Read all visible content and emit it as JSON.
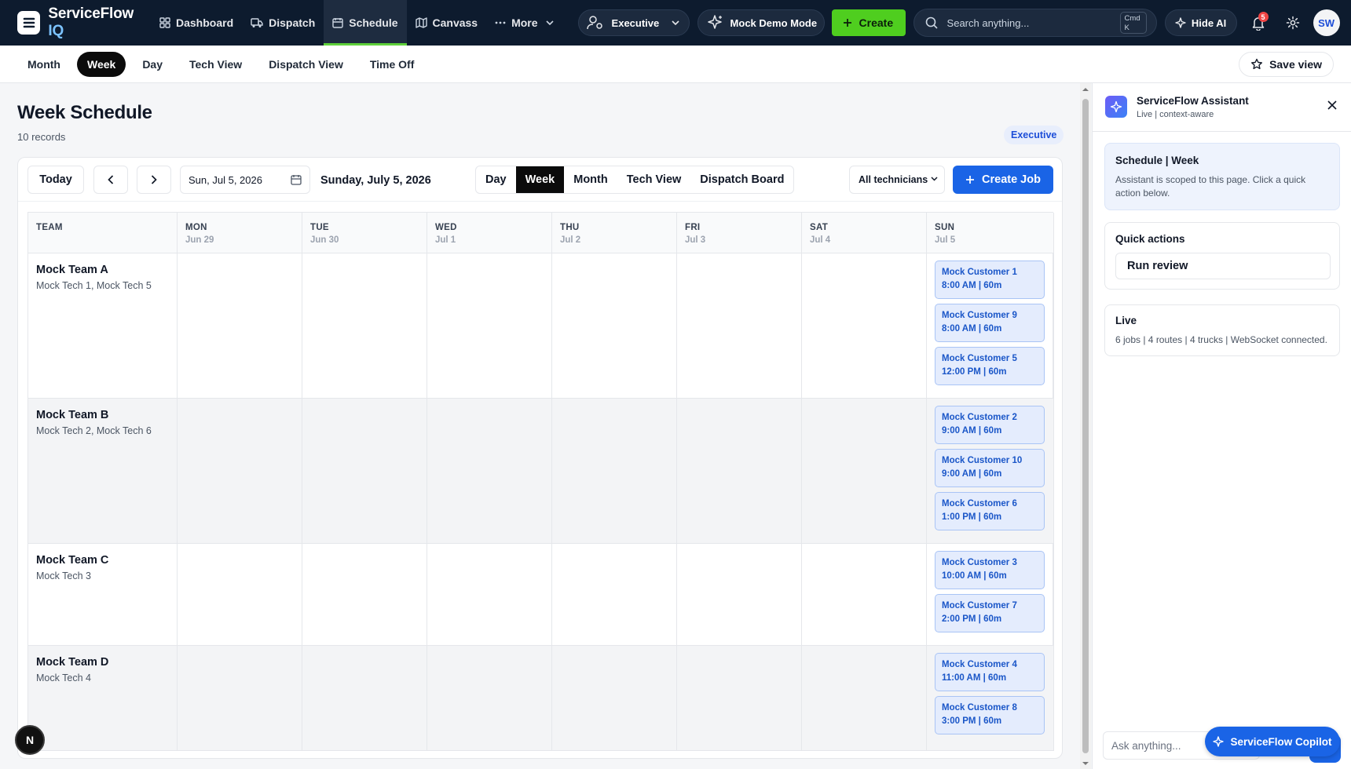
{
  "app": {
    "brand_main": "ServiceFlow",
    "brand_accent": " IQ"
  },
  "nav": {
    "items": [
      {
        "label": "Dashboard",
        "icon": "dashboard-grid-icon"
      },
      {
        "label": "Dispatch",
        "icon": "truck-icon"
      },
      {
        "label": "Schedule",
        "icon": "calendar-icon",
        "active": true
      },
      {
        "label": "Canvass",
        "icon": "map-icon"
      },
      {
        "label": "More",
        "icon": "ellipsis-icon"
      }
    ],
    "role": "Executive",
    "demo_mode": "Mock Demo Mode",
    "create": "Create",
    "search_placeholder": "Search anything...",
    "search_kbd_1": "Cmd",
    "search_kbd_2": "K",
    "hide_ai": "Hide AI",
    "notification_count": "5",
    "avatar": "SW"
  },
  "subnav": {
    "tabs": [
      "Month",
      "Week",
      "Day",
      "Tech View",
      "Dispatch View",
      "Time Off"
    ],
    "active_tab": "Week",
    "save_view": "Save view"
  },
  "page": {
    "title": "Week Schedule",
    "records": "10 records",
    "role_tag": "Executive"
  },
  "toolbar": {
    "today": "Today",
    "date_value": "Sun, Jul 5, 2026",
    "date_long": "Sunday, July 5, 2026",
    "views": [
      "Day",
      "Week",
      "Month",
      "Tech View",
      "Dispatch Board"
    ],
    "active_view": "Week",
    "tech_filter": "All technicians",
    "create_job": "Create Job"
  },
  "grid": {
    "team_header": "TEAM",
    "days": [
      {
        "dow": "MON",
        "date": "Jun 29"
      },
      {
        "dow": "TUE",
        "date": "Jun 30"
      },
      {
        "dow": "WED",
        "date": "Jul 1"
      },
      {
        "dow": "THU",
        "date": "Jul 2"
      },
      {
        "dow": "FRI",
        "date": "Jul 3"
      },
      {
        "dow": "SAT",
        "date": "Jul 4"
      },
      {
        "dow": "SUN",
        "date": "Jul 5"
      }
    ],
    "teams": [
      {
        "name": "Mock Team A",
        "techs": "Mock Tech 1, Mock Tech 5",
        "jobs": [
          {
            "customer": "Mock Customer 1",
            "time": "8:00 AM | 60m"
          },
          {
            "customer": "Mock Customer 9",
            "time": "8:00 AM | 60m"
          },
          {
            "customer": "Mock Customer 5",
            "time": "12:00 PM | 60m"
          }
        ]
      },
      {
        "name": "Mock Team B",
        "techs": "Mock Tech 2, Mock Tech 6",
        "jobs": [
          {
            "customer": "Mock Customer 2",
            "time": "9:00 AM | 60m"
          },
          {
            "customer": "Mock Customer 10",
            "time": "9:00 AM | 60m"
          },
          {
            "customer": "Mock Customer 6",
            "time": "1:00 PM | 60m"
          }
        ]
      },
      {
        "name": "Mock Team C",
        "techs": "Mock Tech 3",
        "jobs": [
          {
            "customer": "Mock Customer 3",
            "time": "10:00 AM | 60m"
          },
          {
            "customer": "Mock Customer 7",
            "time": "2:00 PM | 60m"
          }
        ]
      },
      {
        "name": "Mock Team D",
        "techs": "Mock Tech 4",
        "jobs": [
          {
            "customer": "Mock Customer 4",
            "time": "11:00 AM | 60m"
          },
          {
            "customer": "Mock Customer 8",
            "time": "3:00 PM | 60m"
          }
        ]
      }
    ]
  },
  "assistant": {
    "title": "ServiceFlow Assistant",
    "subtitle": "Live | context-aware",
    "context_title": "Schedule | Week",
    "context_text": "Assistant is scoped to this page. Click a quick action below.",
    "quick_title": "Quick actions",
    "quick_action": "Run review",
    "live_title": "Live",
    "live_text": "6 jobs | 4 routes | 4 trucks | WebSocket connected.",
    "ask_placeholder": "Ask anything...",
    "copilot": "ServiceFlow Copilot"
  },
  "dev_badge": "N",
  "colors": {
    "nav_bg": "#0d1b2e",
    "accent_green": "#4fce1f",
    "primary_blue": "#1a64e6",
    "job_bg": "#e4ecfd"
  }
}
